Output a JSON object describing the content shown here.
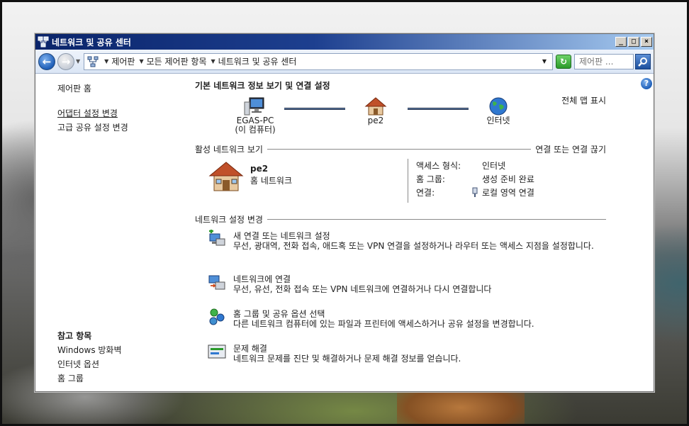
{
  "window": {
    "title": "네트워크 및 공유 센터",
    "controls": {
      "minimize": "_",
      "maximize": "□",
      "close": "×"
    }
  },
  "addressbar": {
    "breadcrumbs": [
      "제어판",
      "모든 제어판 항목",
      "네트워크 및 공유 센터"
    ],
    "search_placeholder": "제어판 ..."
  },
  "sidebar": {
    "links": [
      "제어판 홈",
      "어댑터 설정 변경",
      "고급 공유 설정 변경"
    ],
    "see_also_heading": "참고 항목",
    "see_also": [
      "Windows 방화벽",
      "인터넷 옵션",
      "홈 그룹"
    ]
  },
  "main": {
    "heading": "기본 네트워크 정보 보기 및 연결 설정",
    "full_map": "전체 맵 표시",
    "map": {
      "computer_name": "EGAS-PC",
      "computer_sub": "(이 컴퓨터)",
      "network": "pe2",
      "internet": "인터넷"
    },
    "active_section": "활성 네트워크 보기",
    "connect_disconnect": "연결 또는 연결 끊기",
    "active": {
      "name": "pe2",
      "type": "홈 네트워크",
      "access_label": "액세스 형식:",
      "access_value": "인터넷",
      "homegroup_label": "홈 그룹:",
      "homegroup_value": "생성 준비 완료",
      "connection_label": "연결:",
      "connection_value": "로컬 영역 연결"
    },
    "change_section": "네트워크 설정 변경",
    "tasks": [
      {
        "title": "새 연결 또는 네트워크 설정",
        "desc": "무선, 광대역, 전화 접속, 애드혹 또는 VPN 연결을 설정하거나 라우터 또는 액세스 지점을 설정합니다.",
        "icon": "new-connection-icon"
      },
      {
        "title": "네트워크에 연결",
        "desc": "무선, 유선, 전화 접속 또는 VPN 네트워크에 연결하거나 다시 연결합니다",
        "icon": "connect-network-icon"
      },
      {
        "title": "홈 그룹 및 공유 옵션 선택",
        "desc": "다른 네트워크 컴퓨터에 있는 파일과 프린터에 액세스하거나 공유 설정을 변경합니다.",
        "icon": "homegroup-icon"
      },
      {
        "title": "문제 해결",
        "desc": "네트워크 문제를 진단 및 해결하거나 문제 해결 정보를 얻습니다.",
        "icon": "troubleshoot-icon"
      }
    ]
  }
}
